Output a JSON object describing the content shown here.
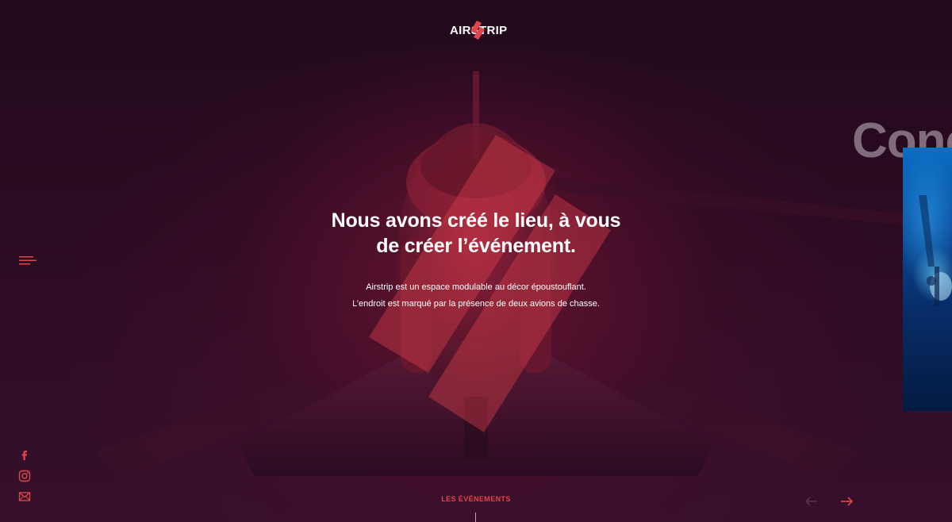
{
  "brand": {
    "name": "AIRSTRIP",
    "accent_color": "#e0464b"
  },
  "nav": {
    "menu_icon": "menu-icon"
  },
  "hero": {
    "title_line1": "Nous avons créé le lieu, à vous",
    "title_line2": "de créer l’événement.",
    "text_line1": "Airstrip est un espace modulable au décor époustouflant.",
    "text_line2": "L’endroit est marqué par la présence de deux avions de chasse."
  },
  "next_slide": {
    "title": "Conc"
  },
  "social": [
    {
      "icon": "facebook-icon"
    },
    {
      "icon": "instagram-icon"
    },
    {
      "icon": "mail-icon"
    }
  ],
  "footer": {
    "events_label": "LES ÉVÉNEMENTS",
    "prev_icon": "arrow-left-icon",
    "next_icon": "arrow-right-icon"
  }
}
